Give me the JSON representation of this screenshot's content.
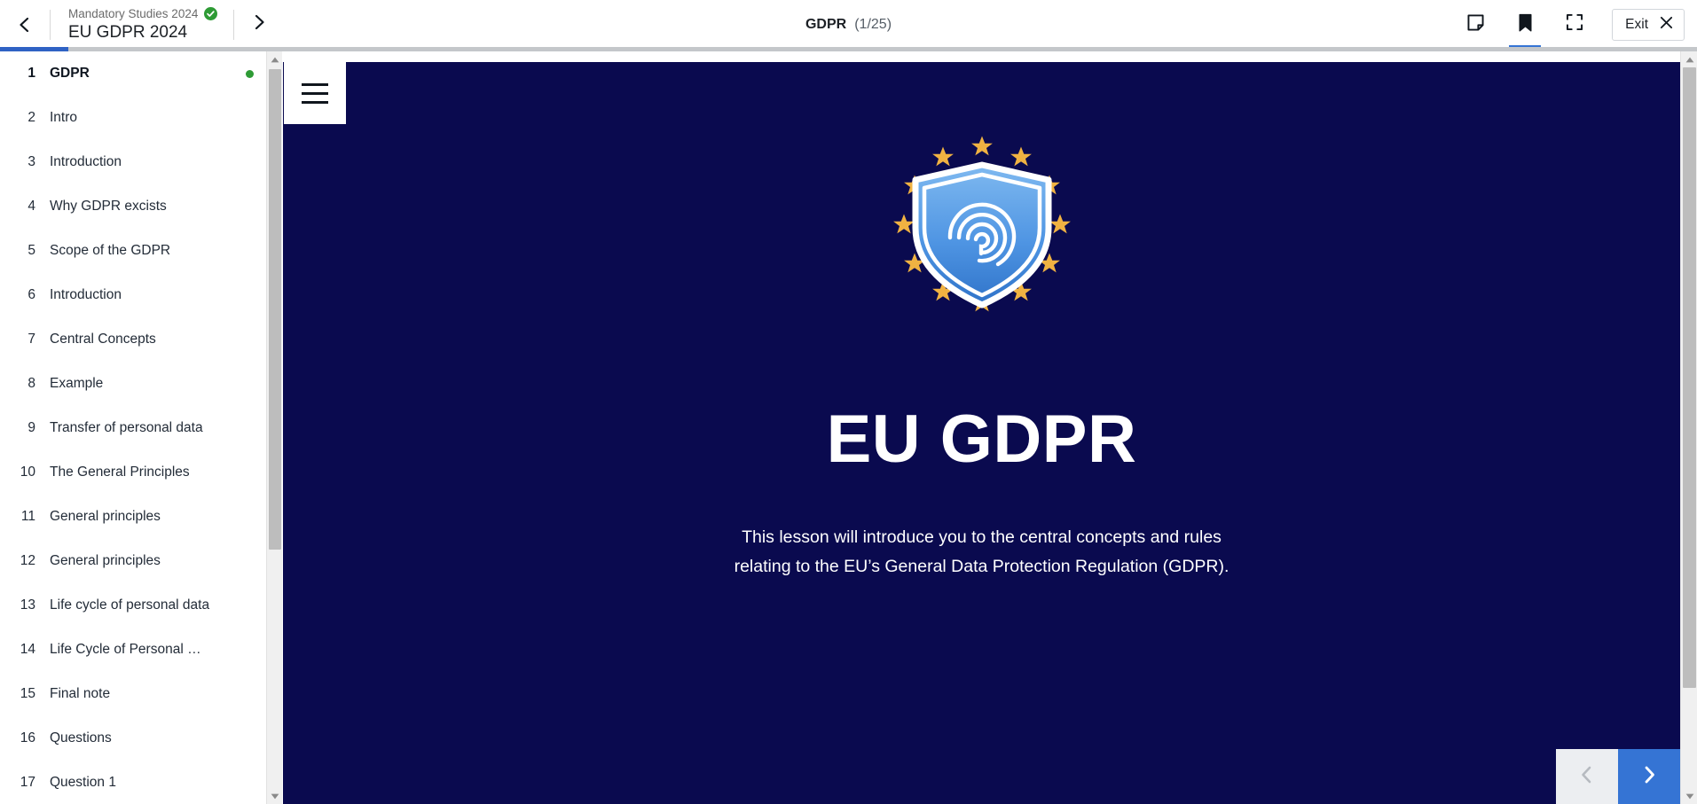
{
  "header": {
    "back_icon": "chevron-left-icon",
    "forward_icon": "chevron-right-icon",
    "course_name": "Mandatory Studies 2024",
    "course_status_icon": "check-circle-icon",
    "lesson_name": "EU GDPR 2024",
    "slide_title": "GDPR",
    "slide_count": "(1/25)",
    "notes_icon": "note-icon",
    "bookmark_icon": "bookmark-icon",
    "fullscreen_icon": "fullscreen-icon",
    "exit_label": "Exit",
    "close_icon": "close-icon",
    "active_tool": "bookmark",
    "accent_color": "#3574d4"
  },
  "progress": {
    "percent": 4,
    "fill_color": "#2f62c4",
    "track_color": "#c4c7ca"
  },
  "sidebar": {
    "scroll_up_icon": "triangle-up-icon",
    "scroll_down_icon": "triangle-down-icon",
    "current_index": 1,
    "status_dot_color": "#2e9b35",
    "items": [
      {
        "num": "1",
        "label": "GDPR",
        "current": true,
        "dot": true
      },
      {
        "num": "2",
        "label": "Intro",
        "current": false,
        "dot": false
      },
      {
        "num": "3",
        "label": "Introduction",
        "current": false,
        "dot": false
      },
      {
        "num": "4",
        "label": "Why GDPR excists",
        "current": false,
        "dot": false
      },
      {
        "num": "5",
        "label": "Scope of the GDPR",
        "current": false,
        "dot": false
      },
      {
        "num": "6",
        "label": "Introduction",
        "current": false,
        "dot": false
      },
      {
        "num": "7",
        "label": "Central Concepts",
        "current": false,
        "dot": false
      },
      {
        "num": "8",
        "label": "Example",
        "current": false,
        "dot": false
      },
      {
        "num": "9",
        "label": "Transfer of personal data",
        "current": false,
        "dot": false
      },
      {
        "num": "10",
        "label": "The General Principles",
        "current": false,
        "dot": false
      },
      {
        "num": "11",
        "label": "General principles",
        "current": false,
        "dot": false
      },
      {
        "num": "12",
        "label": "General principles",
        "current": false,
        "dot": false
      },
      {
        "num": "13",
        "label": "Life cycle of personal data",
        "current": false,
        "dot": false
      },
      {
        "num": "14",
        "label": "Life Cycle of Personal …",
        "current": false,
        "dot": false
      },
      {
        "num": "15",
        "label": "Final note",
        "current": false,
        "dot": false
      },
      {
        "num": "16",
        "label": "Questions",
        "current": false,
        "dot": false
      },
      {
        "num": "17",
        "label": "Question 1",
        "current": false,
        "dot": false
      }
    ]
  },
  "slide": {
    "menu_icon": "hamburger-menu-icon",
    "background_color": "#0a0a4f",
    "emblem_icon": "eu-gdpr-shield-fingerprint-icon",
    "emblem_star_color": "#f0b242",
    "emblem_star_count": 12,
    "heading": "EU GDPR",
    "paragraph": "This lesson will introduce you to the central concepts and rules relating to the EU’s General Data Protection Regulation (GDPR)."
  },
  "slide_nav": {
    "prev_icon": "chevron-left-icon",
    "next_icon": "chevron-right-icon",
    "prev_enabled": false,
    "next_enabled": true,
    "next_color": "#3574d4"
  },
  "page_scroll": {
    "up_icon": "triangle-up-icon",
    "down_icon": "triangle-down-icon"
  }
}
